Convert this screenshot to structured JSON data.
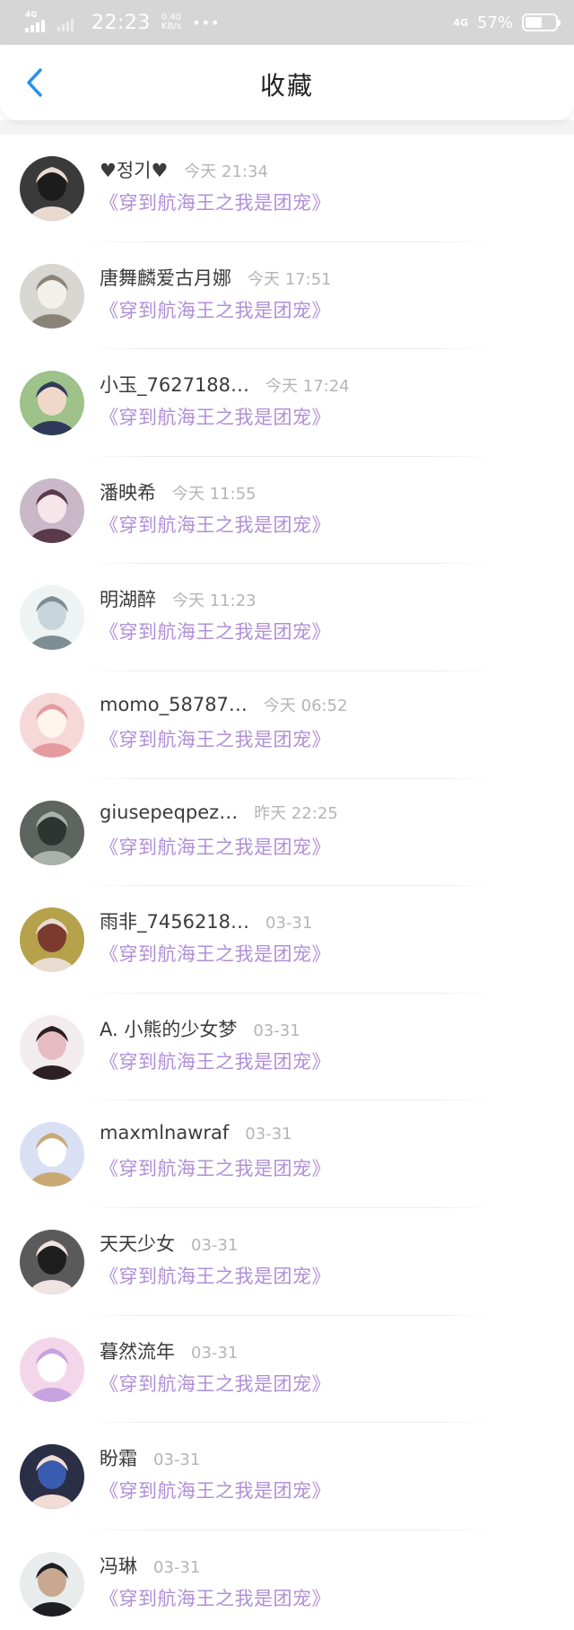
{
  "status_bar": {
    "network_left": "4G",
    "time": "22:23",
    "speed_value": "0.40",
    "speed_unit": "KB/s",
    "dots": "•••",
    "network_right": "4G",
    "battery_percent": "57%",
    "battery_level": 0.57
  },
  "header": {
    "title": "收藏"
  },
  "colors": {
    "accent": "#2d8ff0",
    "book_title": "#b08fd6",
    "time": "#b5b5b5",
    "status_bar_bg": "#d6d6d6"
  },
  "favorites": [
    {
      "name": "♥정기♥",
      "time": "今天 21:34",
      "book": "《穿到航海王之我是团宠》"
    },
    {
      "name": "唐舞麟爱古月娜",
      "time": "今天 17:51",
      "book": "《穿到航海王之我是团宠》"
    },
    {
      "name": "小玉_7627188…",
      "time": "今天 17:24",
      "book": "《穿到航海王之我是团宠》"
    },
    {
      "name": "潘映希",
      "time": "今天 11:55",
      "book": "《穿到航海王之我是团宠》"
    },
    {
      "name": "明湖醉",
      "time": "今天 11:23",
      "book": "《穿到航海王之我是团宠》"
    },
    {
      "name": "momo_58787…",
      "time": "今天 06:52",
      "book": "《穿到航海王之我是团宠》"
    },
    {
      "name": "giusepeqpez…",
      "time": "昨天 22:25",
      "book": "《穿到航海王之我是团宠》"
    },
    {
      "name": "雨非_7456218…",
      "time": "03-31",
      "book": "《穿到航海王之我是团宠》"
    },
    {
      "name": "A. 小熊的少女梦",
      "time": "03-31",
      "book": "《穿到航海王之我是团宠》"
    },
    {
      "name": "maxmlnawraf",
      "time": "03-31",
      "book": "《穿到航海王之我是团宠》"
    },
    {
      "name": "天天少女",
      "time": "03-31",
      "book": "《穿到航海王之我是团宠》"
    },
    {
      "name": "暮然流年",
      "time": "03-31",
      "book": "《穿到航海王之我是团宠》"
    },
    {
      "name": "盼霜",
      "time": "03-31",
      "book": "《穿到航海王之我是团宠》"
    },
    {
      "name": "冯琳",
      "time": "03-31",
      "book": "《穿到航海王之我是团宠》"
    }
  ]
}
